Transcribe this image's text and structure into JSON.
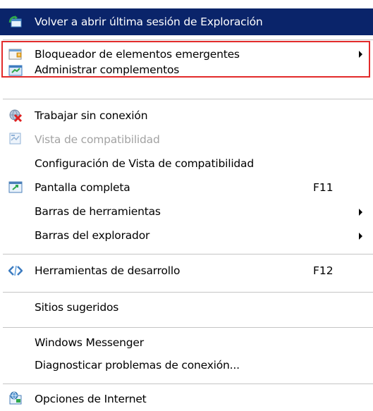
{
  "menu": {
    "items": [
      {
        "label": "Volver a abrir última sesión de Exploración",
        "icon": "reopen-session-icon"
      },
      {
        "label": "Bloqueador de elementos emergentes",
        "icon": "popup-blocker-icon"
      },
      {
        "label": "Administrar complementos",
        "icon": "manage-addons-icon"
      },
      {
        "label": "Trabajar sin conexión",
        "icon": "work-offline-icon"
      },
      {
        "label": "Vista de compatibilidad",
        "icon": "compatibility-view-icon"
      },
      {
        "label": "Configuración de Vista de compatibilidad"
      },
      {
        "label": "Pantalla completa",
        "shortcut": "F11",
        "icon": "fullscreen-icon"
      },
      {
        "label": "Barras de herramientas"
      },
      {
        "label": "Barras del explorador"
      },
      {
        "label": "Herramientas de desarrollo",
        "shortcut": "F12",
        "icon": "developer-tools-icon"
      },
      {
        "label": "Sitios sugeridos"
      },
      {
        "label": "Windows Messenger"
      },
      {
        "label": "Diagnosticar problemas de conexión..."
      },
      {
        "label": "Opciones de Internet",
        "icon": "internet-options-icon"
      }
    ]
  },
  "colors": {
    "highlight": "#0a246a",
    "highlight_text": "#ffffff",
    "annotation_border": "#e22b2b",
    "disabled_text": "#a3a3a3"
  }
}
